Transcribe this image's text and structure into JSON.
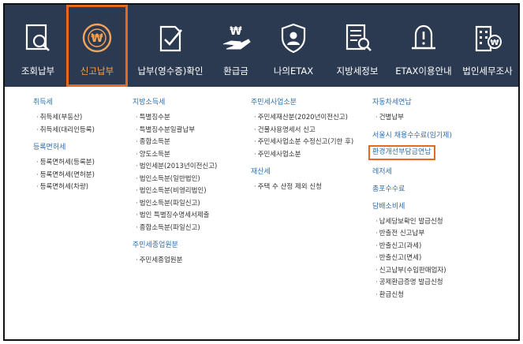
{
  "nav": {
    "items": [
      {
        "label": "조회납부",
        "icon": "search-document-icon"
      },
      {
        "label": "신고납부",
        "icon": "won-coin-icon"
      },
      {
        "label": "납부(영수증)확인",
        "icon": "receipt-check-icon"
      },
      {
        "label": "환급금",
        "icon": "refund-hand-icon"
      },
      {
        "label": "나의ETAX",
        "icon": "user-shield-icon"
      },
      {
        "label": "지방세정보",
        "icon": "info-document-icon"
      },
      {
        "label": "ETAX이용안내",
        "icon": "notice-bell-icon"
      },
      {
        "label": "법인세무조사",
        "icon": "building-won-icon"
      }
    ]
  },
  "menu": {
    "col1": {
      "g1": {
        "heading": "취득세",
        "items": [
          "취득세(부동산)",
          "취득세(대리인등록)"
        ]
      },
      "g2": {
        "heading": "등록면허세",
        "items": [
          "등록면허세(등록분)",
          "등록면허세(면허분)",
          "등록면허세(차량)"
        ]
      }
    },
    "col2": {
      "g1": {
        "heading": "지방소득세",
        "items": [
          "특별징수분",
          "특별징수분일괄납부",
          "종합소득분",
          "양도소득분",
          "법인세분(2013년이전신고)",
          "법인소득분(일반법인)",
          "법인소득분(비영리법인)",
          "법인소득분(파일신고)",
          "법인 특별징수명세서제출",
          "종합소득분(파일신고)"
        ]
      },
      "g2": {
        "heading": "주민세종업원분",
        "items": [
          "주민세종업원분"
        ]
      }
    },
    "col3": {
      "g1": {
        "heading": "주민세사업소분",
        "items": [
          "주민세재산분(2020년이전신고)",
          "건물사용명세서 신고",
          "주민세사업소분 수정신고(기한 후)",
          "주민세사업소분"
        ]
      },
      "g2": {
        "heading": "재산세",
        "items": [
          "주택 수 산정 제외 신청"
        ]
      }
    },
    "col4": {
      "g1": {
        "heading": "자동차세연납",
        "items": [
          "건별납부"
        ]
      },
      "h2": "서울시 채용수수료(임기제)",
      "h3": "환경개선부담금연납",
      "h4": "레저세",
      "h5": "총포수수료",
      "g6": {
        "heading": "담배소비세",
        "items": [
          "납세담보확인 발급신청",
          "반출전 신고납부",
          "반출신고(과세)",
          "반출신고(면세)",
          "신고납부(수입판매업자)",
          "공제환급증명 발급신청",
          "환급신청"
        ]
      }
    }
  },
  "colors": {
    "bar": "#2b3a51",
    "accent": "#e66a1e",
    "link": "#2f6fb0"
  }
}
